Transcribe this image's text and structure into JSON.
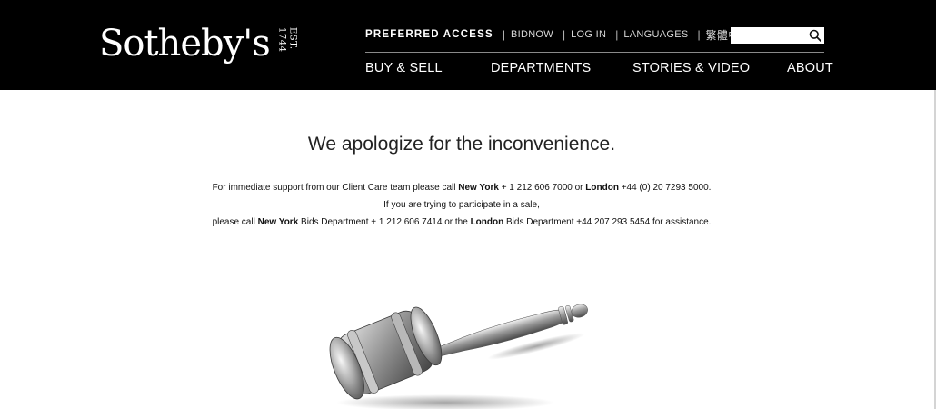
{
  "header": {
    "logo": {
      "wordmark": "Sotheby's",
      "est": "EST. 1744"
    },
    "utility_nav": {
      "preferred": "PREFERRED ACCESS",
      "links": [
        "BIDNOW",
        "LOG IN",
        "LANGUAGES",
        "繁體中文"
      ]
    },
    "search": {
      "value": "",
      "placeholder": "",
      "icon": "search-icon"
    },
    "main_nav": [
      "BUY & SELL",
      "DEPARTMENTS",
      "STORIES & VIDEO",
      "ABOUT"
    ]
  },
  "main": {
    "headline": "We apologize for the inconvenience.",
    "line1": {
      "a": "For immediate support from our Client Care team please call",
      "city1": "New York",
      "b": "+ 1 212 606 7000 or",
      "city2": "London",
      "c": "+44 (0) 20 7293 5000."
    },
    "line2": "If you are trying to participate in a sale,",
    "line3": {
      "a": "please call",
      "city1": "New York",
      "b": "Bids Department + 1 212 606 7414 or the",
      "city2": "London",
      "c": "Bids Department +44 207 293 5454 for assistance."
    },
    "image": "gavel-image"
  },
  "colors": {
    "header_bg": "#000000",
    "page_bg": "#ffffff",
    "text": "#111111"
  }
}
